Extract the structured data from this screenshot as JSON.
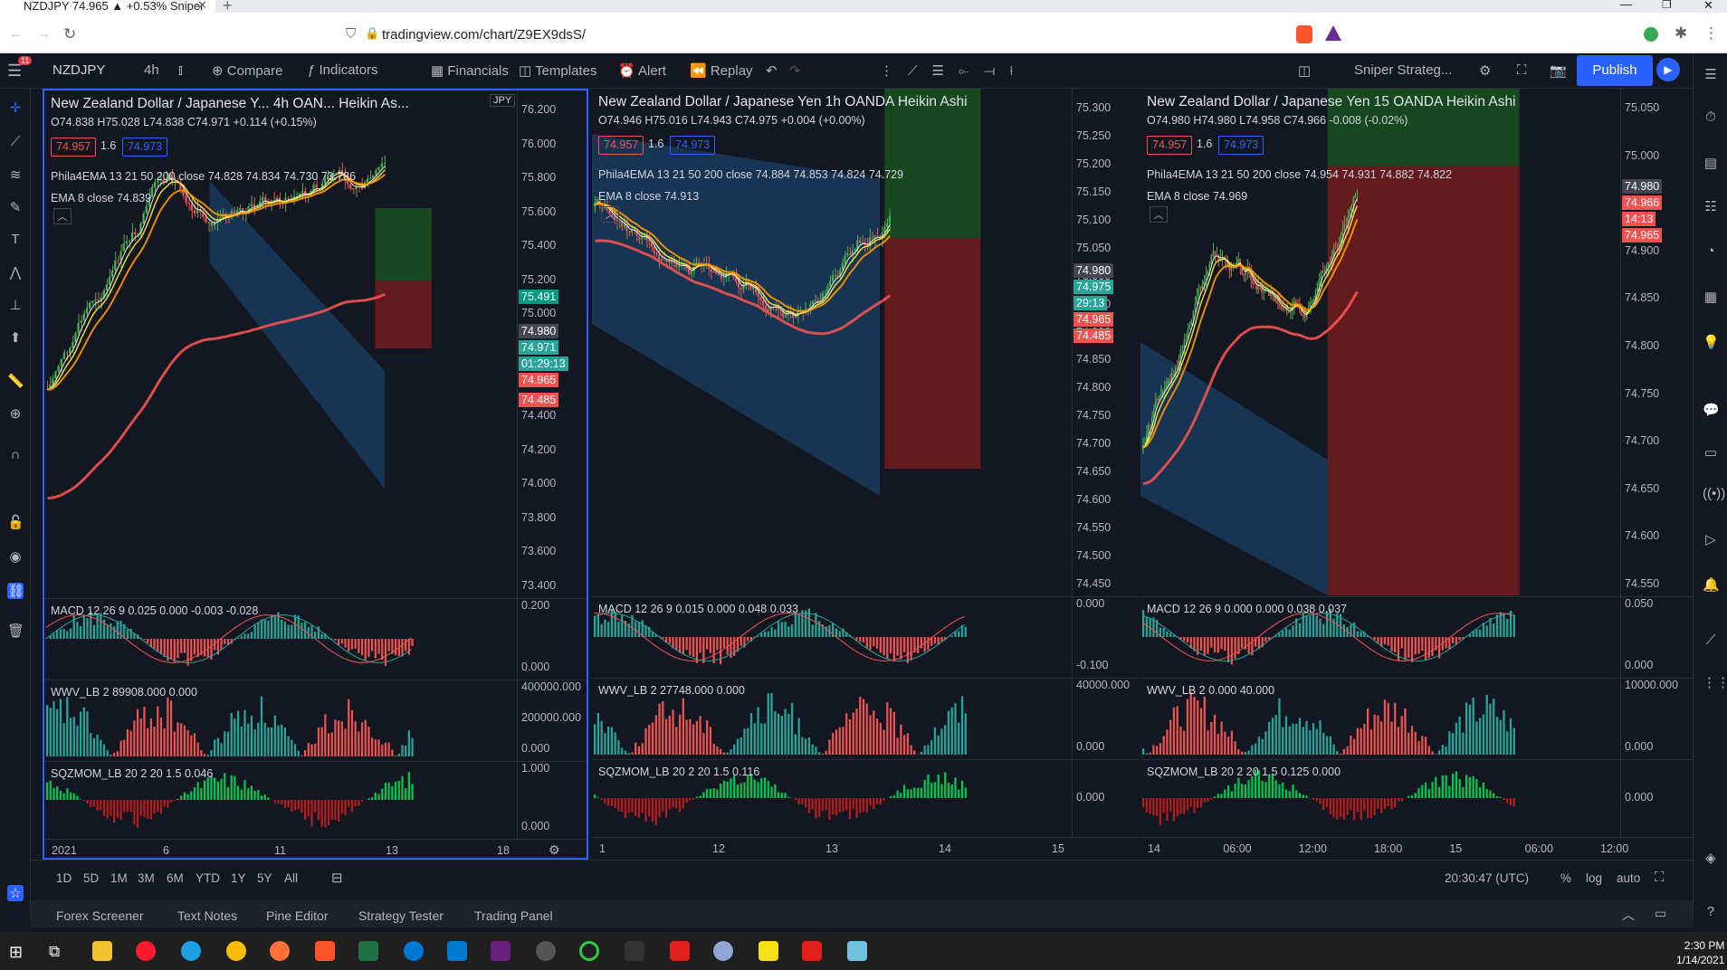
{
  "browser": {
    "tab_title": "NZDJPY 74.965 ▲ +0.53% Sniper",
    "url": "tradingview.com/chart/Z9EX9dsS/",
    "new_tab": "+",
    "minimize": "—",
    "maximize": "❐",
    "close": "✕"
  },
  "toolbar": {
    "symbol": "NZDJPY",
    "interval": "4h",
    "compare": "Compare",
    "indicators": "Indicators",
    "financials": "Financials",
    "templates": "Templates",
    "alert": "Alert",
    "replay": "Replay",
    "layout_name": "Sniper Strateg...",
    "publish": "Publish",
    "notif_count": "11"
  },
  "colors": {
    "up": "#4caf50",
    "down": "#ef5350",
    "ema8": "#ffffff",
    "ema13": "#ffeb3b",
    "ema21": "#ff9800",
    "ema200": "#ef5350",
    "accent": "#2962ff",
    "long_zone": "#1b5e20",
    "short_zone": "#7f1d1d",
    "channel": "#1e4d7b"
  },
  "panes": [
    {
      "title": "New Zealand Dollar / Japanese Y...   4h   OAN...   Heikin As...",
      "ohlc": "O74.838  H75.028  L74.838  C74.971  +0.114 (+0.15%)",
      "sell": "74.957",
      "spread": "1.6",
      "buy": "74.973",
      "ema_line": "Phila4EMA 13 21 50 200 close  74.828  74.834  74.730  73.786",
      "ema8": "EMA 8 close  74.839",
      "currency": "JPY",
      "price_axis": [
        "76.200",
        "76.000",
        "75.800",
        "75.600",
        "75.400",
        "75.200",
        "75.000",
        "74.800",
        "74.600",
        "74.400",
        "74.200",
        "74.000",
        "73.800",
        "73.600",
        "73.400"
      ],
      "tags": [
        {
          "t": "75.491",
          "c": "#089981"
        },
        {
          "t": "74.980",
          "c": "#434651"
        },
        {
          "t": "74.971",
          "c": "#26a69a"
        },
        {
          "t": "01:29:13",
          "c": "#26a69a"
        },
        {
          "t": "74.965",
          "c": "#ef5350"
        },
        {
          "t": "74.485",
          "c": "#ef5350"
        }
      ],
      "macd": "MACD 12 26 9  0.025  0.000  -0.003  -0.028",
      "macd_axis": [
        "0.200",
        "0.000"
      ],
      "wwv": "WWV_LB 2  89908.000  0.000",
      "wwv_axis": [
        "400000.000",
        "200000.000",
        "0.000"
      ],
      "sqz": "SQZMOM_LB 20 2 20 1.5  0.046",
      "sqz_axis": [
        "1.000",
        "0.000"
      ],
      "time_axis": [
        "2021",
        "6",
        "11",
        "13",
        "18"
      ]
    },
    {
      "title": "New Zealand Dollar / Japanese Yen   1h   OANDA   Heikin Ashi",
      "ohlc": "O74.946  H75.016  L74.943  C74.975  +0.004 (+0.00%)",
      "sell": "74.957",
      "spread": "1.6",
      "buy": "74.973",
      "ema_line": "Phila4EMA 13 21 50 200 close  74.884  74.853  74.824  74.729",
      "ema8": "EMA 8 close  74.913",
      "price_axis": [
        "75.300",
        "75.250",
        "75.200",
        "75.150",
        "75.100",
        "75.050",
        "75.000",
        "74.950",
        "74.900",
        "74.850",
        "74.800",
        "74.750",
        "74.700",
        "74.650",
        "74.600",
        "74.550",
        "74.500",
        "74.450"
      ],
      "tags": [
        {
          "t": "74.980",
          "c": "#434651"
        },
        {
          "t": "74.975",
          "c": "#26a69a"
        },
        {
          "t": "29:13",
          "c": "#26a69a"
        },
        {
          "t": "74.965",
          "c": "#ef5350"
        },
        {
          "t": "74.485",
          "c": "#ef5350"
        }
      ],
      "macd": "MACD 12 26 9  0.015  0.000  0.048  0.033",
      "macd_axis": [
        "0.000",
        "-0.100"
      ],
      "wwv": "WWV_LB 2  27748.000  0.000",
      "wwv_axis": [
        "40000.000",
        "0.000"
      ],
      "sqz": "SQZMOM_LB 20 2 20 1.5  0.116",
      "sqz_axis": [
        "0.000"
      ],
      "time_axis": [
        "1",
        "12",
        "13",
        "14",
        "15"
      ]
    },
    {
      "title": "New Zealand Dollar / Japanese Yen   15   OANDA   Heikin Ashi",
      "ohlc": "O74.980  H74.980  L74.958  C74.966  -0.008 (-0.02%)",
      "sell": "74.957",
      "spread": "1.6",
      "buy": "74.973",
      "ema_line": "Phila4EMA 13 21 50 200 close  74.954  74.931  74.882  74.822",
      "ema8": "EMA 8 close  74.969",
      "price_axis": [
        "75.050",
        "75.000",
        "74.950",
        "74.900",
        "74.850",
        "74.800",
        "74.750",
        "74.700",
        "74.650",
        "74.600",
        "74.550"
      ],
      "tags": [
        {
          "t": "74.980",
          "c": "#434651"
        },
        {
          "t": "74.966",
          "c": "#ef5350"
        },
        {
          "t": "14:13",
          "c": "#ef5350"
        },
        {
          "t": "74.965",
          "c": "#ef5350"
        }
      ],
      "macd": "MACD 12 26 9  0.000  0.000  0.038  0.037",
      "macd_axis": [
        "0.050",
        "0.000"
      ],
      "wwv": "WWV_LB 2  0.000  40.000",
      "wwv_axis": [
        "10000.000",
        "0.000"
      ],
      "sqz": "SQZMOM_LB 20 2 20 1.5  0.125  0.000",
      "sqz_axis": [
        "0.000"
      ],
      "time_axis": [
        "14",
        "06:00",
        "12:00",
        "18:00",
        "15",
        "06:00",
        "12:00"
      ]
    }
  ],
  "timeframes": [
    "1D",
    "5D",
    "1M",
    "3M",
    "6M",
    "YTD",
    "1Y",
    "5Y",
    "All"
  ],
  "status": {
    "clock": "20:30:47 (UTC)",
    "percent": "%",
    "log": "log",
    "auto": "auto"
  },
  "bottom_tabs": [
    "Forex Screener",
    "Text Notes",
    "Pine Editor",
    "Strategy Tester",
    "Trading Panel"
  ],
  "taskbar": {
    "time": "2:30 PM",
    "date": "1/14/2021"
  }
}
